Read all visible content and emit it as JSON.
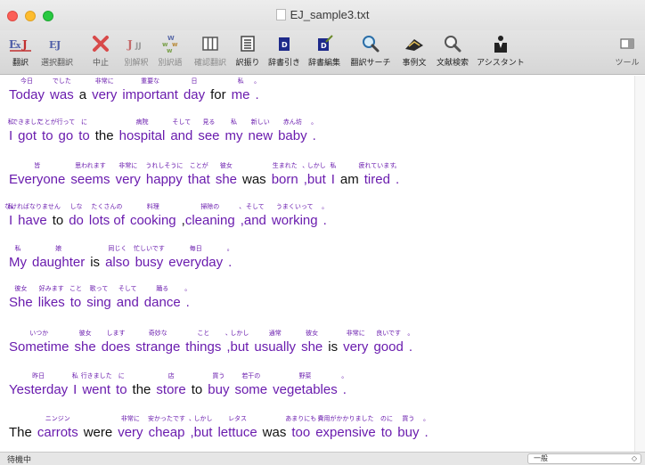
{
  "window": {
    "title": "EJ_sample3.txt"
  },
  "toolbar": {
    "items": [
      {
        "icon": "translate-icon",
        "label": "翻訳"
      },
      {
        "icon": "selection-translate-icon",
        "label": "選択翻訳"
      },
      {
        "icon": "stop-icon",
        "label": "中止"
      },
      {
        "icon": "alternate-translation-icon",
        "label": "別解釈"
      },
      {
        "icon": "alternate-word-icon",
        "label": "別訳語"
      },
      {
        "icon": "confirm-translation-icon",
        "label": "確認翻訳"
      },
      {
        "icon": "annotation-icon",
        "label": "訳振り"
      },
      {
        "icon": "dictionary-lookup-icon",
        "label": "辞書引き"
      },
      {
        "icon": "dictionary-edit-icon",
        "label": "辞書編集"
      },
      {
        "icon": "translation-search-icon",
        "label": "翻訳サーチ"
      },
      {
        "icon": "example-sentence-icon",
        "label": "事例文"
      },
      {
        "icon": "literature-search-icon",
        "label": "文献検索"
      },
      {
        "icon": "assistant-icon",
        "label": "アシスタント"
      }
    ],
    "right_item": {
      "icon": "tool-icon",
      "label": "ツール"
    }
  },
  "colors": {
    "translated_word": "#6a1cae",
    "untranslated_word": "#111111"
  },
  "sentences": [
    [
      [
        "Today",
        "今日",
        "p"
      ],
      [
        "was",
        "でした",
        "p"
      ],
      [
        "a",
        "",
        "b"
      ],
      [
        "very",
        "非常に",
        "p"
      ],
      [
        "important",
        "重要な",
        "p"
      ],
      [
        "day",
        "日",
        "p"
      ],
      [
        "for",
        "",
        "b"
      ],
      [
        "me",
        "私",
        "p"
      ],
      [
        ".",
        "。",
        "p"
      ]
    ],
    [
      [
        "I",
        "私",
        "p"
      ],
      [
        "got",
        "できました",
        "p"
      ],
      [
        "to",
        "ことが",
        "p"
      ],
      [
        "go",
        "行って",
        "p"
      ],
      [
        "to",
        "に",
        "p"
      ],
      [
        "the",
        "",
        "b"
      ],
      [
        "hospital",
        "病院",
        "p"
      ],
      [
        "and",
        "そして",
        "p"
      ],
      [
        "see",
        "見る",
        "p"
      ],
      [
        "my",
        "私",
        "p"
      ],
      [
        "new",
        "新しい",
        "p"
      ],
      [
        "baby",
        "赤ん坊",
        "p"
      ],
      [
        ".",
        "。",
        "p"
      ]
    ],
    [
      [
        "Everyone",
        "皆",
        "p"
      ],
      [
        "seems",
        "思われます",
        "p"
      ],
      [
        "very",
        "非常に",
        "p"
      ],
      [
        "happy",
        "うれしそうに",
        "p"
      ],
      [
        "that",
        "ことが",
        "p"
      ],
      [
        "she",
        "彼女",
        "p"
      ],
      [
        "was",
        "",
        "b"
      ],
      [
        "born",
        "生まれた",
        "p"
      ],
      [
        ",",
        "、",
        "p"
      ],
      [
        "but",
        "しかし",
        "p"
      ],
      [
        "I",
        "私",
        "p"
      ],
      [
        "am",
        "",
        "b"
      ],
      [
        "tired",
        "疲れています",
        "p"
      ],
      [
        ".",
        "。",
        "p"
      ]
    ],
    [
      [
        "I",
        "私",
        "p"
      ],
      [
        "have",
        "なければなりません",
        "p"
      ],
      [
        "to",
        "",
        "b"
      ],
      [
        "do",
        "しな",
        "p"
      ],
      [
        "lots of",
        "たくさんの",
        "p"
      ],
      [
        "cooking",
        "料理",
        "p"
      ],
      [
        ",",
        "",
        "b"
      ],
      [
        "cleaning",
        "掃除の",
        "p"
      ],
      [
        ",",
        "、",
        "p"
      ],
      [
        "and",
        "そして",
        "p"
      ],
      [
        "working",
        "うまくいって",
        "p"
      ],
      [
        ".",
        "。",
        "p"
      ]
    ],
    [
      [
        "My",
        "私",
        "p"
      ],
      [
        "daughter",
        "娘",
        "p"
      ],
      [
        "is",
        "",
        "b"
      ],
      [
        "also",
        "同じく",
        "p"
      ],
      [
        "busy",
        "忙しいです",
        "p"
      ],
      [
        "everyday",
        "毎日",
        "p"
      ],
      [
        ".",
        "。",
        "p"
      ]
    ],
    [
      [
        "She",
        "彼女",
        "p"
      ],
      [
        "likes",
        "好みます",
        "p"
      ],
      [
        "to",
        "こと",
        "p"
      ],
      [
        "sing",
        "歌って",
        "p"
      ],
      [
        "and",
        "そして",
        "p"
      ],
      [
        "dance",
        "踊る",
        "p"
      ],
      [
        ".",
        "。",
        "p"
      ]
    ],
    [
      [
        "Sometime",
        "いつか",
        "p"
      ],
      [
        "she",
        "彼女",
        "p"
      ],
      [
        "does",
        "します",
        "p"
      ],
      [
        "strange",
        "奇妙な",
        "p"
      ],
      [
        "things",
        "こと",
        "p"
      ],
      [
        ",",
        "、",
        "p"
      ],
      [
        "but",
        "しかし",
        "p"
      ],
      [
        "usually",
        "通常",
        "p"
      ],
      [
        "she",
        "彼女",
        "p"
      ],
      [
        "is",
        "",
        "b"
      ],
      [
        "very",
        "非常に",
        "p"
      ],
      [
        "good",
        "良いです",
        "p"
      ],
      [
        ".",
        "。",
        "p"
      ]
    ],
    [
      [
        "Yesterday",
        "昨日",
        "p"
      ],
      [
        "I",
        "私",
        "p"
      ],
      [
        "went",
        "行きました",
        "p"
      ],
      [
        "to",
        "に",
        "p"
      ],
      [
        "the",
        "",
        "b"
      ],
      [
        "store",
        "店",
        "p"
      ],
      [
        "to",
        "",
        "b"
      ],
      [
        "buy",
        "買う",
        "p"
      ],
      [
        "some",
        "若干の",
        "p"
      ],
      [
        "vegetables",
        "野菜",
        "p"
      ],
      [
        ".",
        "。",
        "p"
      ]
    ],
    [
      [
        "The",
        "",
        "b"
      ],
      [
        "carrots",
        "ニンジン",
        "p"
      ],
      [
        "were",
        "",
        "b"
      ],
      [
        "very",
        "非常に",
        "p"
      ],
      [
        "cheap",
        "安かったです",
        "p"
      ],
      [
        ",",
        "、",
        "p"
      ],
      [
        "but",
        "しかし",
        "p"
      ],
      [
        "lettuce",
        "レタス",
        "p"
      ],
      [
        "was",
        "",
        "b"
      ],
      [
        "too",
        "あまりにも",
        "p"
      ],
      [
        "expensive",
        "費用がかかりました",
        "p"
      ],
      [
        "to",
        "のに",
        "p"
      ],
      [
        "buy",
        "買う",
        "p"
      ],
      [
        ".",
        "。",
        "p"
      ]
    ]
  ],
  "status": {
    "left": "待機中",
    "select_value": "一般"
  }
}
